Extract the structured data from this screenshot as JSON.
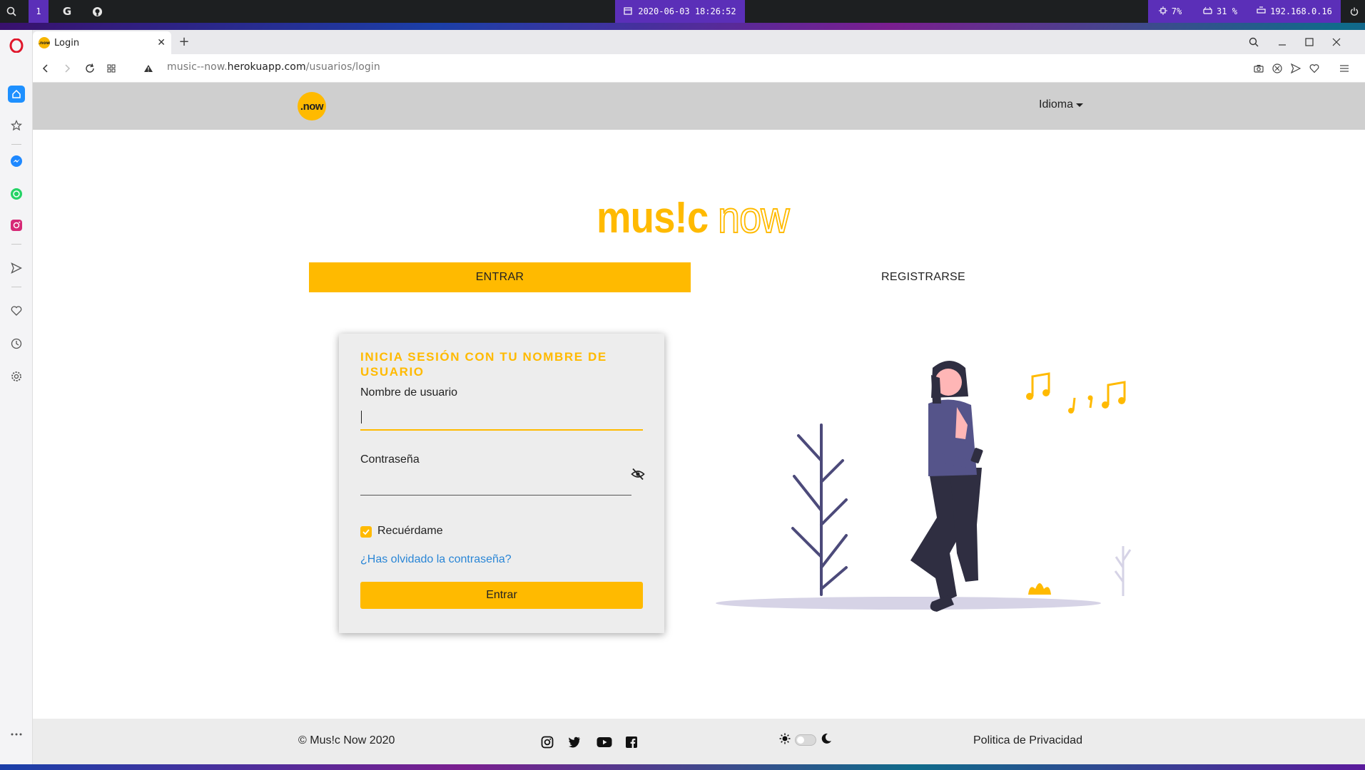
{
  "os_bar": {
    "workspace": "1",
    "g_label": "G",
    "datetime": "2020-06-03 18:26:52",
    "cpu": "7%",
    "disk": "31 %",
    "ip": "192.168.0.16"
  },
  "browser": {
    "tab_title": "Login",
    "favicon_text": ".now",
    "url_prefix": "music--now.",
    "url_host": "herokuapp.com",
    "url_path": "/usuarios/login"
  },
  "navbar": {
    "logo_text": ".now",
    "language_label": "Idioma"
  },
  "brand": {
    "music": "mus!c",
    "now": "now"
  },
  "tabs": {
    "login": "ENTRAR",
    "register": "REGISTRARSE"
  },
  "login_form": {
    "heading": "INICIA SESIÓN CON TU NOMBRE DE USUARIO",
    "username_label": "Nombre de usuario",
    "username_value": "",
    "password_label": "Contraseña",
    "password_value": "",
    "remember_label": "Recuérdame",
    "remember_checked": true,
    "forgot_link": "¿Has olvidado la contraseña?",
    "submit_label": "Entrar"
  },
  "footer": {
    "copyright": "© Mus!c Now 2020",
    "social": [
      "instagram-icon",
      "twitter-icon",
      "youtube-icon",
      "facebook-icon"
    ],
    "privacy": "Politica de Privacidad"
  },
  "colors": {
    "accent": "#ffba00",
    "link": "#2a86d6",
    "navbar": "#cfcfcf",
    "os_accent": "#5b2fb8"
  }
}
